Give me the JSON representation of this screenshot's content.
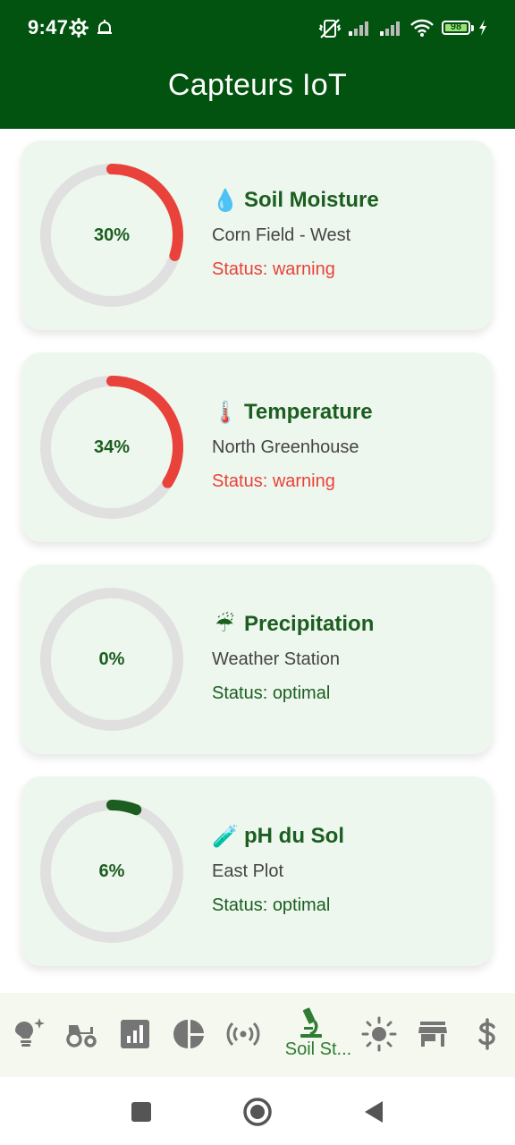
{
  "status_bar": {
    "time": "9:47",
    "battery_level": "98",
    "battery_fraction": 0.98,
    "icons": [
      "settings-gear-icon",
      "notification-bell-icon",
      "vibrate-off-icon",
      "signal-icon",
      "signal-icon",
      "wifi-icon",
      "battery-icon",
      "charging-bolt-icon"
    ]
  },
  "app_bar": {
    "title": "Capteurs IoT"
  },
  "sensors": [
    {
      "emoji": "💧",
      "name": "Soil Moisture",
      "location": "Corn Field - West",
      "status": "Status: warning",
      "value_label": "30%",
      "level": 0.3,
      "color": "#e8423a"
    },
    {
      "emoji": "🌡️",
      "name": "Temperature",
      "location": "North Greenhouse",
      "status": "Status: warning",
      "value_label": "34%",
      "level": 0.34,
      "color": "#e8423a"
    },
    {
      "emoji": "☔",
      "name": "Precipitation",
      "location": "Weather Station",
      "status": "Status: optimal",
      "value_label": "0%",
      "level": 0.0,
      "color": "#1b5e20"
    },
    {
      "emoji": "🧪",
      "name": "pH du Sol",
      "location": "East Plot",
      "status": "Status: optimal",
      "value_label": "6%",
      "level": 0.06,
      "color": "#1b5e20"
    }
  ],
  "bottom_nav": {
    "items": [
      {
        "icon": "lightbulb-sparkle-icon"
      },
      {
        "icon": "tractor-icon"
      },
      {
        "icon": "bar-chart-icon"
      },
      {
        "icon": "pie-chart-icon"
      },
      {
        "icon": "sensors-icon"
      },
      {
        "icon": "microscope-icon",
        "label": "Soil St...",
        "active": true
      },
      {
        "icon": "sun-icon"
      },
      {
        "icon": "store-icon"
      },
      {
        "icon": "dollar-icon"
      }
    ]
  },
  "colors": {
    "primary": "#02530f",
    "warning": "#e8423a",
    "card_bg": "#eef7ee",
    "nav_bg": "#f4f8ee"
  }
}
